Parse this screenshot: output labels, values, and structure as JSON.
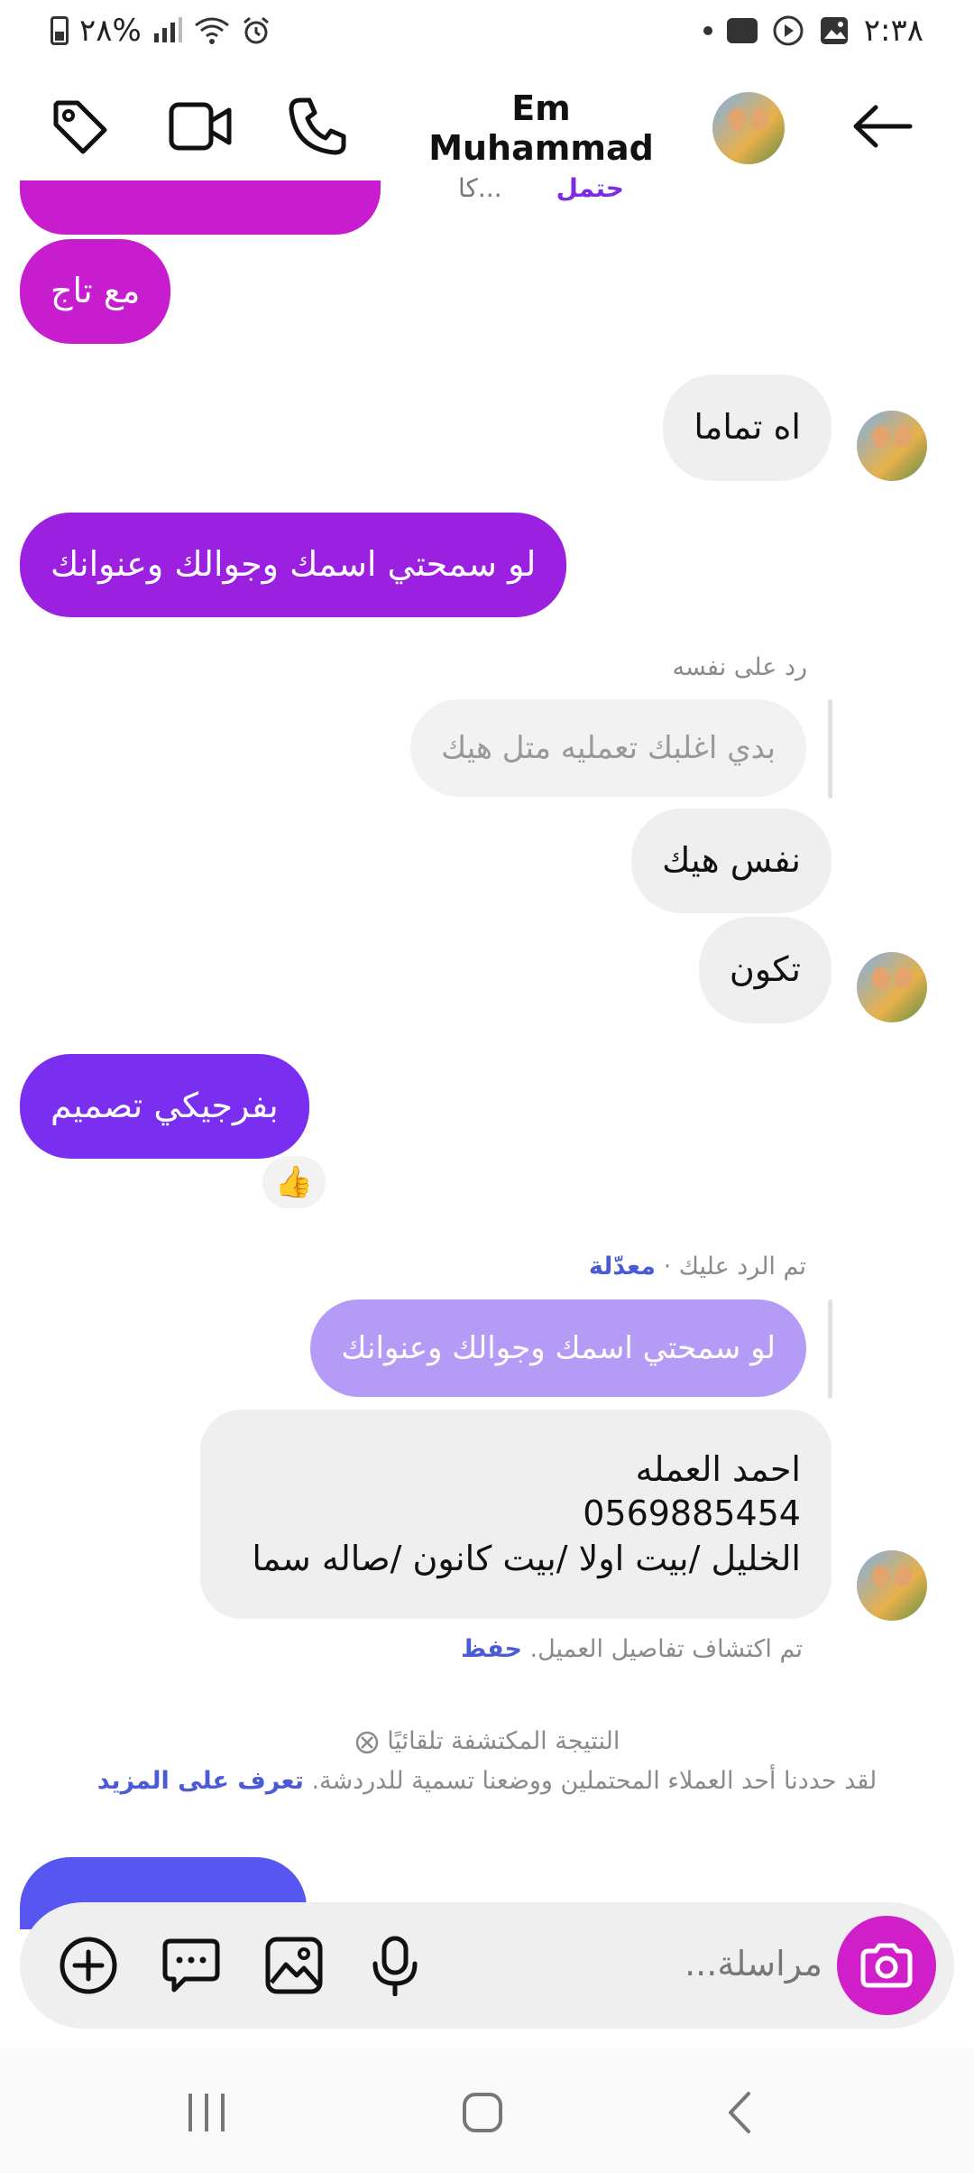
{
  "status_bar": {
    "time": "٢:٣٨",
    "battery_text": "٢٨%",
    "battery_percent": 28
  },
  "header": {
    "contact_name": "Em Muhammad",
    "label_potential": "حتمل",
    "typing_text": "كا..."
  },
  "messages": {
    "m0_text": "مع تاج",
    "m1_text": "اه تماما",
    "m2_text": "لو سمحتي اسمك وجوالك وعنوانك",
    "m3_meta": "رد على نفسه",
    "m3_quoted": "بدي اغلبك تعمليه متل هيك",
    "m4_text": "نفس هيك",
    "m5_text": "تكون",
    "m6_text": "بفرجيكي تصميم",
    "m6_reaction": "👍",
    "m7_meta_prefix": "تم الرد عليك · ",
    "m7_meta_edited": "معدّلة",
    "m7_quoted": "لو سمحتي اسمك وجوالك وعنوانك",
    "m8_line1": "احمد العمله",
    "m8_line2": "0569885454",
    "m8_line3": "الخليل /بيت اولا /بيت كانون /صاله سما",
    "m8_detected": "تم اكتشاف تفاصيل العميل. ",
    "m8_save": "حفظ"
  },
  "auto_detect": {
    "title": "النتيجة المكتشفة تلقائيًا",
    "body": "لقد حددنا أحد العملاء المحتملين ووضعنا تسمية للدردشة. ",
    "learn_more": "تعرف على المزيد"
  },
  "composer": {
    "placeholder": "مراسلة..."
  },
  "icons": {
    "back": "arrow-left-icon",
    "phone": "phone-icon",
    "video": "video-camera-icon",
    "tag": "tag-icon",
    "camera": "camera-icon",
    "mic": "microphone-icon",
    "gallery": "image-icon",
    "sticker": "chat-bubble-icon",
    "plus": "plus-circle-icon"
  },
  "colors": {
    "bubble_magenta": "#c81ccf",
    "bubble_purple": "#9b20e0",
    "bubble_violet": "#7a2ef0",
    "bubble_indigo": "#5856f0",
    "quoted_lavender": "#b49cf6",
    "incoming_bg": "#efefef",
    "camera_button": "#d01fc8",
    "link_blue": "#4b5bd6",
    "potential_label": "#7d2ce0"
  }
}
